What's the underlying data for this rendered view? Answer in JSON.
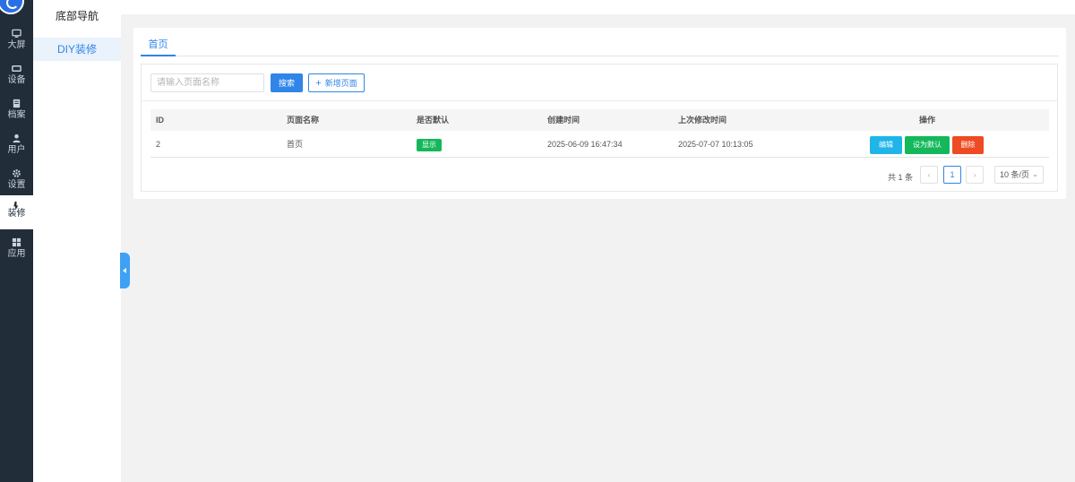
{
  "rail": {
    "items": [
      {
        "label": "大屏",
        "icon": "monitor-icon"
      },
      {
        "label": "设备",
        "icon": "device-icon"
      },
      {
        "label": "档案",
        "icon": "archive-icon"
      },
      {
        "label": "用户",
        "icon": "user-icon"
      },
      {
        "label": "设置",
        "icon": "gear-icon"
      },
      {
        "label": "装修",
        "icon": "brush-icon"
      },
      {
        "label": "应用",
        "icon": "apps-icon"
      }
    ]
  },
  "subnav": {
    "title": "底部导航",
    "item": "DIY装修"
  },
  "tabs": {
    "home": "首页"
  },
  "toolbar": {
    "search_placeholder": "请输入页面名称",
    "search_label": "搜索",
    "add_label": "新增页面"
  },
  "table": {
    "headers": {
      "id": "ID",
      "name": "页面名称",
      "default": "是否默认",
      "created": "创建时间",
      "updated": "上次修改时间",
      "ops": "操作"
    },
    "rows": [
      {
        "id": "2",
        "name": "首页",
        "default": "显示",
        "created": "2025-06-09 16:47:34",
        "updated": "2025-07-07 10:13:05",
        "edit": "编辑",
        "set_default": "设为默认",
        "delete": "删除"
      }
    ]
  },
  "pagination": {
    "total": "共 1 条",
    "prev": "‹",
    "current": "1",
    "next": "›",
    "page_size": "10 条/页"
  },
  "colors": {
    "primary": "#2f85e8",
    "rail_bg": "#222d3a",
    "success": "#14b85a",
    "info": "#1fb5e9",
    "danger": "#ee4a23"
  }
}
